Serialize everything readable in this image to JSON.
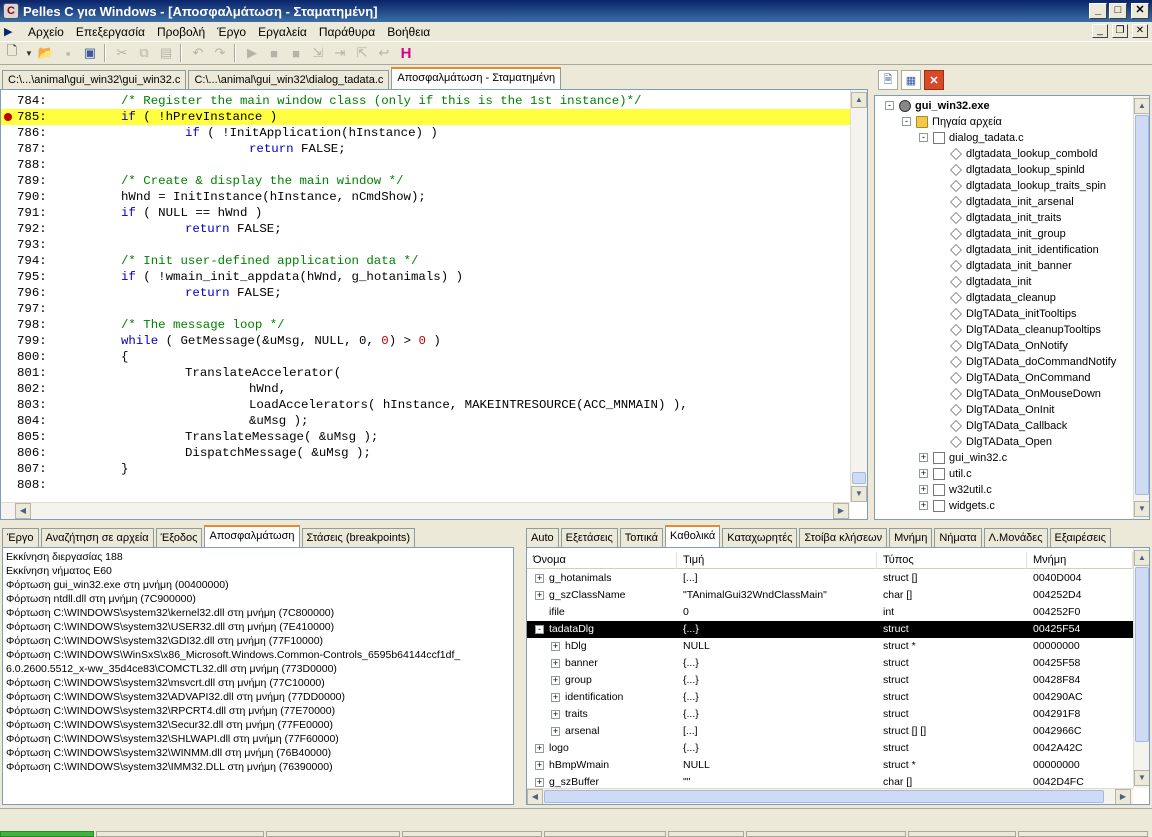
{
  "window": {
    "title": "Pelles C για Windows - [Αποσφαλμάτωση - Σταματημένη]",
    "app_icon": "C"
  },
  "menu": [
    "Αρχείο",
    "Επεξεργασία",
    "Προβολή",
    "Έργο",
    "Εργαλεία",
    "Παράθυρα",
    "Βοήθεια"
  ],
  "toolbar": {
    "icons": [
      "new-file-icon",
      "open-file-icon",
      "save-icon",
      "save-all-icon",
      "cut-icon",
      "copy-icon",
      "paste-icon",
      "undo-icon",
      "redo-icon",
      "go-icon",
      "stop-icon",
      "break-icon",
      "step-into-icon",
      "step-over-icon",
      "step-out-icon",
      "resource-icon"
    ],
    "special_glyph": "H",
    "special_color": "#d4008f"
  },
  "editor_tabs": [
    {
      "label": "C:\\...\\animal\\gui_win32\\gui_win32.c",
      "active": false
    },
    {
      "label": "C:\\...\\animal\\gui_win32\\dialog_tadata.c",
      "active": false
    },
    {
      "label": "Αποσφαλμάτωση - Σταματημένη",
      "active": true
    }
  ],
  "code": {
    "highlight_color": "#ffff40",
    "breakpoint_color": "#c00000",
    "lines": [
      {
        "num": "784:",
        "text": "/* Register the main window class (only if this is the 1st instance)*/",
        "kind": "comment",
        "indent": 1
      },
      {
        "num": "785:",
        "text": "if ( !hPrevInstance )",
        "kind": "code",
        "indent": 1,
        "current": true,
        "breakpoint": true
      },
      {
        "num": "786:",
        "text": "if ( !InitApplication(hInstance) )",
        "kind": "code",
        "indent": 2
      },
      {
        "num": "787:",
        "text": "return FALSE;",
        "kind": "code",
        "indent": 3
      },
      {
        "num": "788:",
        "text": "",
        "kind": "code",
        "indent": 1
      },
      {
        "num": "789:",
        "text": "/* Create & display the main window */",
        "kind": "comment",
        "indent": 1
      },
      {
        "num": "790:",
        "text": "hWnd = InitInstance(hInstance, nCmdShow);",
        "kind": "code",
        "indent": 1
      },
      {
        "num": "791:",
        "text": "if ( NULL == hWnd )",
        "kind": "code",
        "indent": 1
      },
      {
        "num": "792:",
        "text": "return FALSE;",
        "kind": "code",
        "indent": 2
      },
      {
        "num": "793:",
        "text": "",
        "kind": "code",
        "indent": 1
      },
      {
        "num": "794:",
        "text": "/* Init user-defined application data */",
        "kind": "comment",
        "indent": 1
      },
      {
        "num": "795:",
        "text": "if ( !wmain_init_appdata(hWnd, g_hotanimals) )",
        "kind": "code",
        "indent": 1
      },
      {
        "num": "796:",
        "text": "return FALSE;",
        "kind": "code",
        "indent": 2
      },
      {
        "num": "797:",
        "text": "",
        "kind": "code",
        "indent": 1
      },
      {
        "num": "798:",
        "text": "/* The message loop */",
        "kind": "comment",
        "indent": 1
      },
      {
        "num": "799:",
        "text": "while ( GetMessage(&uMsg, NULL, 0, 0) > 0 )",
        "kind": "code",
        "indent": 1
      },
      {
        "num": "800:",
        "text": "{",
        "kind": "code",
        "indent": 1
      },
      {
        "num": "801:",
        "text": "TranslateAccelerator(",
        "kind": "code",
        "indent": 2
      },
      {
        "num": "802:",
        "text": "hWnd,",
        "kind": "code",
        "indent": 3
      },
      {
        "num": "803:",
        "text": "LoadAccelerators( hInstance, MAKEINTRESOURCE(ACC_MNMAIN) ),",
        "kind": "code",
        "indent": 3
      },
      {
        "num": "804:",
        "text": "&uMsg );",
        "kind": "code",
        "indent": 3
      },
      {
        "num": "805:",
        "text": "TranslateMessage( &uMsg );",
        "kind": "code",
        "indent": 2
      },
      {
        "num": "806:",
        "text": "DispatchMessage( &uMsg );",
        "kind": "code",
        "indent": 2
      },
      {
        "num": "807:",
        "text": "}",
        "kind": "code",
        "indent": 1
      },
      {
        "num": "808:",
        "text": "",
        "kind": "code",
        "indent": 1
      }
    ]
  },
  "project": {
    "tool_icons": [
      "project-file-icon",
      "project-props-icon",
      "close-project-icon"
    ],
    "tree": [
      {
        "label": "gui_win32.exe",
        "level": 0,
        "icon": "exe",
        "expander": "-",
        "bold": true
      },
      {
        "label": "Πηγαία αρχεία",
        "level": 1,
        "icon": "folder",
        "expander": "-"
      },
      {
        "label": "dialog_tadata.c",
        "level": 2,
        "icon": "file",
        "expander": "-"
      },
      {
        "label": "dlgtadata_lookup_combold",
        "level": 3,
        "icon": "fn"
      },
      {
        "label": "dlgtadata_lookup_spinld",
        "level": 3,
        "icon": "fn"
      },
      {
        "label": "dlgtadata_lookup_traits_spin",
        "level": 3,
        "icon": "fn"
      },
      {
        "label": "dlgtadata_init_arsenal",
        "level": 3,
        "icon": "fn"
      },
      {
        "label": "dlgtadata_init_traits",
        "level": 3,
        "icon": "fn"
      },
      {
        "label": "dlgtadata_init_group",
        "level": 3,
        "icon": "fn"
      },
      {
        "label": "dlgtadata_init_identification",
        "level": 3,
        "icon": "fn"
      },
      {
        "label": "dlgtadata_init_banner",
        "level": 3,
        "icon": "fn"
      },
      {
        "label": "dlgtadata_init",
        "level": 3,
        "icon": "fn"
      },
      {
        "label": "dlgtadata_cleanup",
        "level": 3,
        "icon": "fn"
      },
      {
        "label": "DlgTAData_initTooltips",
        "level": 3,
        "icon": "fn"
      },
      {
        "label": "DlgTAData_cleanupTooltips",
        "level": 3,
        "icon": "fn"
      },
      {
        "label": "DlgTAData_OnNotify",
        "level": 3,
        "icon": "fn"
      },
      {
        "label": "DlgTAData_doCommandNotify",
        "level": 3,
        "icon": "fn"
      },
      {
        "label": "DlgTAData_OnCommand",
        "level": 3,
        "icon": "fn"
      },
      {
        "label": "DlgTAData_OnMouseDown",
        "level": 3,
        "icon": "fn"
      },
      {
        "label": "DlgTAData_OnInit",
        "level": 3,
        "icon": "fn"
      },
      {
        "label": "DlgTAData_Callback",
        "level": 3,
        "icon": "fn"
      },
      {
        "label": "DlgTAData_Open",
        "level": 3,
        "icon": "fn"
      },
      {
        "label": "gui_win32.c",
        "level": 2,
        "icon": "file",
        "expander": "+"
      },
      {
        "label": "util.c",
        "level": 2,
        "icon": "file",
        "expander": "+"
      },
      {
        "label": "w32util.c",
        "level": 2,
        "icon": "file",
        "expander": "+"
      },
      {
        "label": "widgets.c",
        "level": 2,
        "icon": "file",
        "expander": "+"
      }
    ]
  },
  "output_tabs": [
    {
      "label": "Έργο",
      "active": false
    },
    {
      "label": "Αναζήτηση σε αρχεία",
      "active": false
    },
    {
      "label": "Έξοδος",
      "active": false
    },
    {
      "label": "Αποσφαλμάτωση",
      "active": true
    },
    {
      "label": "Στάσεις (breakpoints)",
      "active": false
    }
  ],
  "output_lines": [
    "Εκκίνηση διεργασίας 188",
    "Εκκίνηση νήματος E60",
    "Φόρτωση gui_win32.exe στη μνήμη (00400000)",
    "Φόρτωση ntdll.dll στη μνήμη (7C900000)",
    "Φόρτωση C:\\WINDOWS\\system32\\kernel32.dll στη μνήμη (7C800000)",
    "Φόρτωση C:\\WINDOWS\\system32\\USER32.dll στη μνήμη (7E410000)",
    "Φόρτωση C:\\WINDOWS\\system32\\GDI32.dll στη μνήμη (77F10000)",
    "Φόρτωση C:\\WINDOWS\\WinSxS\\x86_Microsoft.Windows.Common-Controls_6595b64144ccf1df_",
    "6.0.2600.5512_x-ww_35d4ce83\\COMCTL32.dll στη μνήμη (773D0000)",
    "Φόρτωση C:\\WINDOWS\\system32\\msvcrt.dll στη μνήμη (77C10000)",
    "Φόρτωση C:\\WINDOWS\\system32\\ADVAPI32.dll στη μνήμη (77DD0000)",
    "Φόρτωση C:\\WINDOWS\\system32\\RPCRT4.dll στη μνήμη (77E70000)",
    "Φόρτωση C:\\WINDOWS\\system32\\Secur32.dll στη μνήμη (77FE0000)",
    "Φόρτωση C:\\WINDOWS\\system32\\SHLWAPI.dll στη μνήμη (77F60000)",
    "Φόρτωση C:\\WINDOWS\\system32\\WINMM.dll στη μνήμη (76B40000)",
    "Φόρτωση C:\\WINDOWS\\system32\\IMM32.DLL στη μνήμη (76390000)"
  ],
  "debug_tabs": [
    {
      "label": "Auto",
      "active": false
    },
    {
      "label": "Εξετάσεις",
      "active": false
    },
    {
      "label": "Τοπικά",
      "active": false
    },
    {
      "label": "Καθολικά",
      "active": true
    },
    {
      "label": "Καταχωρητές",
      "active": false
    },
    {
      "label": "Στοίβα κλήσεων",
      "active": false
    },
    {
      "label": "Μνήμη",
      "active": false
    },
    {
      "label": "Νήματα",
      "active": false
    },
    {
      "label": "Λ.Μονάδες",
      "active": false
    },
    {
      "label": "Εξαιρέσεις",
      "active": false
    }
  ],
  "globals": {
    "columns": [
      "Όνομα",
      "Τιμή",
      "Τύπος",
      "Μνήμη"
    ],
    "rows": [
      {
        "name": "g_hotanimals",
        "value": "[...]",
        "type": "struct []",
        "mem": "0040D004",
        "expander": "+",
        "level": 0
      },
      {
        "name": "g_szClassName",
        "value": "\"TAnimalGui32WndClassMain\"",
        "type": "char []",
        "mem": "004252D4",
        "expander": "+",
        "level": 0
      },
      {
        "name": "ifile",
        "value": "0",
        "type": "int",
        "mem": "004252F0",
        "expander": "",
        "level": 0
      },
      {
        "name": "tadataDlg",
        "value": "{...}",
        "type": "struct",
        "mem": "00425F54",
        "expander": "-",
        "level": 0,
        "selected": true
      },
      {
        "name": "hDlg",
        "value": "NULL",
        "type": "struct *",
        "mem": "00000000",
        "expander": "+",
        "level": 1
      },
      {
        "name": "banner",
        "value": "{...}",
        "type": "struct",
        "mem": "00425F58",
        "expander": "+",
        "level": 1
      },
      {
        "name": "group",
        "value": "{...}",
        "type": "struct",
        "mem": "00428F84",
        "expander": "+",
        "level": 1
      },
      {
        "name": "identification",
        "value": "{...}",
        "type": "struct",
        "mem": "004290AC",
        "expander": "+",
        "level": 1
      },
      {
        "name": "traits",
        "value": "{...}",
        "type": "struct",
        "mem": "004291F8",
        "expander": "+",
        "level": 1
      },
      {
        "name": "arsenal",
        "value": "[...]",
        "type": "struct [] []",
        "mem": "0042966C",
        "expander": "+",
        "level": 1
      },
      {
        "name": "logo",
        "value": "{...}",
        "type": "struct",
        "mem": "0042A42C",
        "expander": "+",
        "level": 0
      },
      {
        "name": "hBmpWmain",
        "value": "NULL",
        "type": "struct *",
        "mem": "00000000",
        "expander": "+",
        "level": 0
      },
      {
        "name": "g_szBuffer",
        "value": "\"\"",
        "type": "char []",
        "mem": "0042D4FC",
        "expander": "+",
        "level": 0
      }
    ]
  },
  "colors": {
    "titlebar_start": "#0a246a",
    "titlebar_end": "#3a6ea5",
    "comment": "#008000",
    "keyword": "#0000c0",
    "number": "#c00000"
  }
}
